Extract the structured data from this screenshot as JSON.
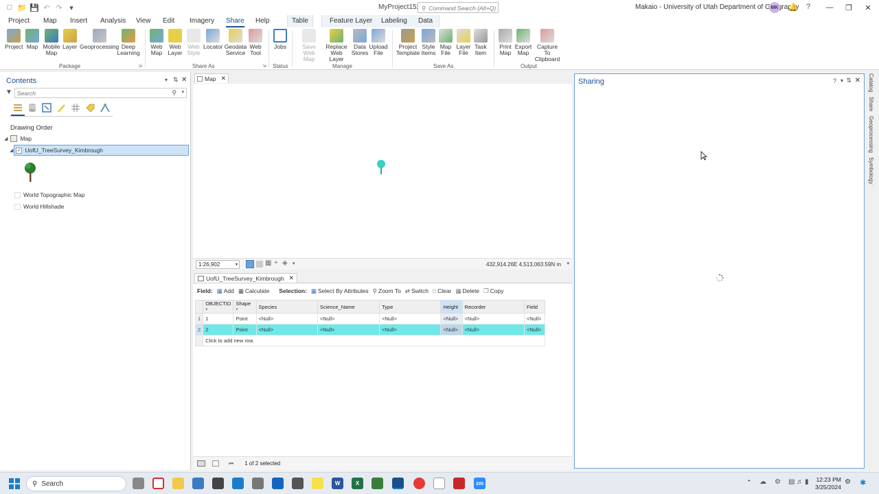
{
  "window": {
    "project": "MyProject152",
    "command_search_placeholder": "Command Search (Alt+Q)",
    "user": "Makaio - University of Utah Department of Geography",
    "avatar": "MK"
  },
  "tabs": [
    "Project",
    "Map",
    "Insert",
    "Analysis",
    "View",
    "Edit",
    "Imagery",
    "Share",
    "Help"
  ],
  "active_tab": "Share",
  "context_tabs": [
    "Table",
    "Feature Layer",
    "Labeling",
    "Data"
  ],
  "ribbon": {
    "package": {
      "label": "Package",
      "buttons": [
        "Project",
        "Map",
        "Mobile Map",
        "Layer",
        "Geoprocessing",
        "Deep Learning"
      ]
    },
    "share_as": {
      "label": "Share As",
      "buttons": [
        "Web Map",
        "Web Layer",
        "Web Style",
        "Locator",
        "Geodata Service",
        "Web Tool"
      ]
    },
    "status": {
      "label": "Status",
      "buttons": [
        "Jobs"
      ]
    },
    "manage": {
      "label": "Manage",
      "buttons": [
        "Save Web Map",
        "Replace Web Layer",
        "Data Stores",
        "Upload File"
      ]
    },
    "save_as": {
      "label": "Save As",
      "buttons": [
        "Project Template",
        "Style Items",
        "Map File",
        "Layer File",
        "Task Item"
      ]
    },
    "output": {
      "label": "Output",
      "buttons": [
        "Print Map",
        "Export Map",
        "Capture To Clipboard"
      ]
    }
  },
  "contents": {
    "title": "Contents",
    "search_placeholder": "Search",
    "drawing_order": "Drawing Order",
    "map_name": "Map",
    "layers": [
      "UofU_TreeSurvey_Kimbrough",
      "World Topographic Map",
      "World Hillshade"
    ]
  },
  "map_view": {
    "tab": "Map",
    "scale": "1:26,902",
    "coordinates": "432,914.26E 4,513,063.59N m"
  },
  "attribute_table": {
    "tab": "UofU_TreeSurvey_Kimbrough",
    "toolbar": {
      "field_label": "Field:",
      "add": "Add",
      "calculate": "Calculate",
      "selection_label": "Selection:",
      "select_by_attributes": "Select By Attributes",
      "zoom_to": "Zoom To",
      "switch": "Switch",
      "clear": "Clear",
      "delete": "Delete",
      "copy": "Copy"
    },
    "columns": [
      "OBJECTID *",
      "Shape *",
      "Species",
      "Science_Name",
      "Type",
      "Height",
      "Recorder",
      "Field"
    ],
    "rows": [
      [
        "1",
        "1",
        "Point",
        "<Null>",
        "<Null>",
        "<Null>",
        "<Null>",
        "<Null>",
        "<Null>"
      ],
      [
        "2",
        "2",
        "Point",
        "<Null>",
        "<Null>",
        "<Null>",
        "<Null>",
        "<Null>",
        "<Null>"
      ]
    ],
    "add_row_hint": "Click to add new row.",
    "status": "1 of 2 selected"
  },
  "sharing": {
    "title": "Sharing"
  },
  "side_tabs": [
    "Catalog",
    "Share",
    "Geoprocessing",
    "Symbology"
  ],
  "taskbar": {
    "search": "Search",
    "time": "12:23 PM",
    "date": "3/25/2024"
  },
  "colors": {
    "accent": "#1a4f8c",
    "selection_row": "#6ee8e8",
    "layer_selected": "#cde3f7"
  }
}
